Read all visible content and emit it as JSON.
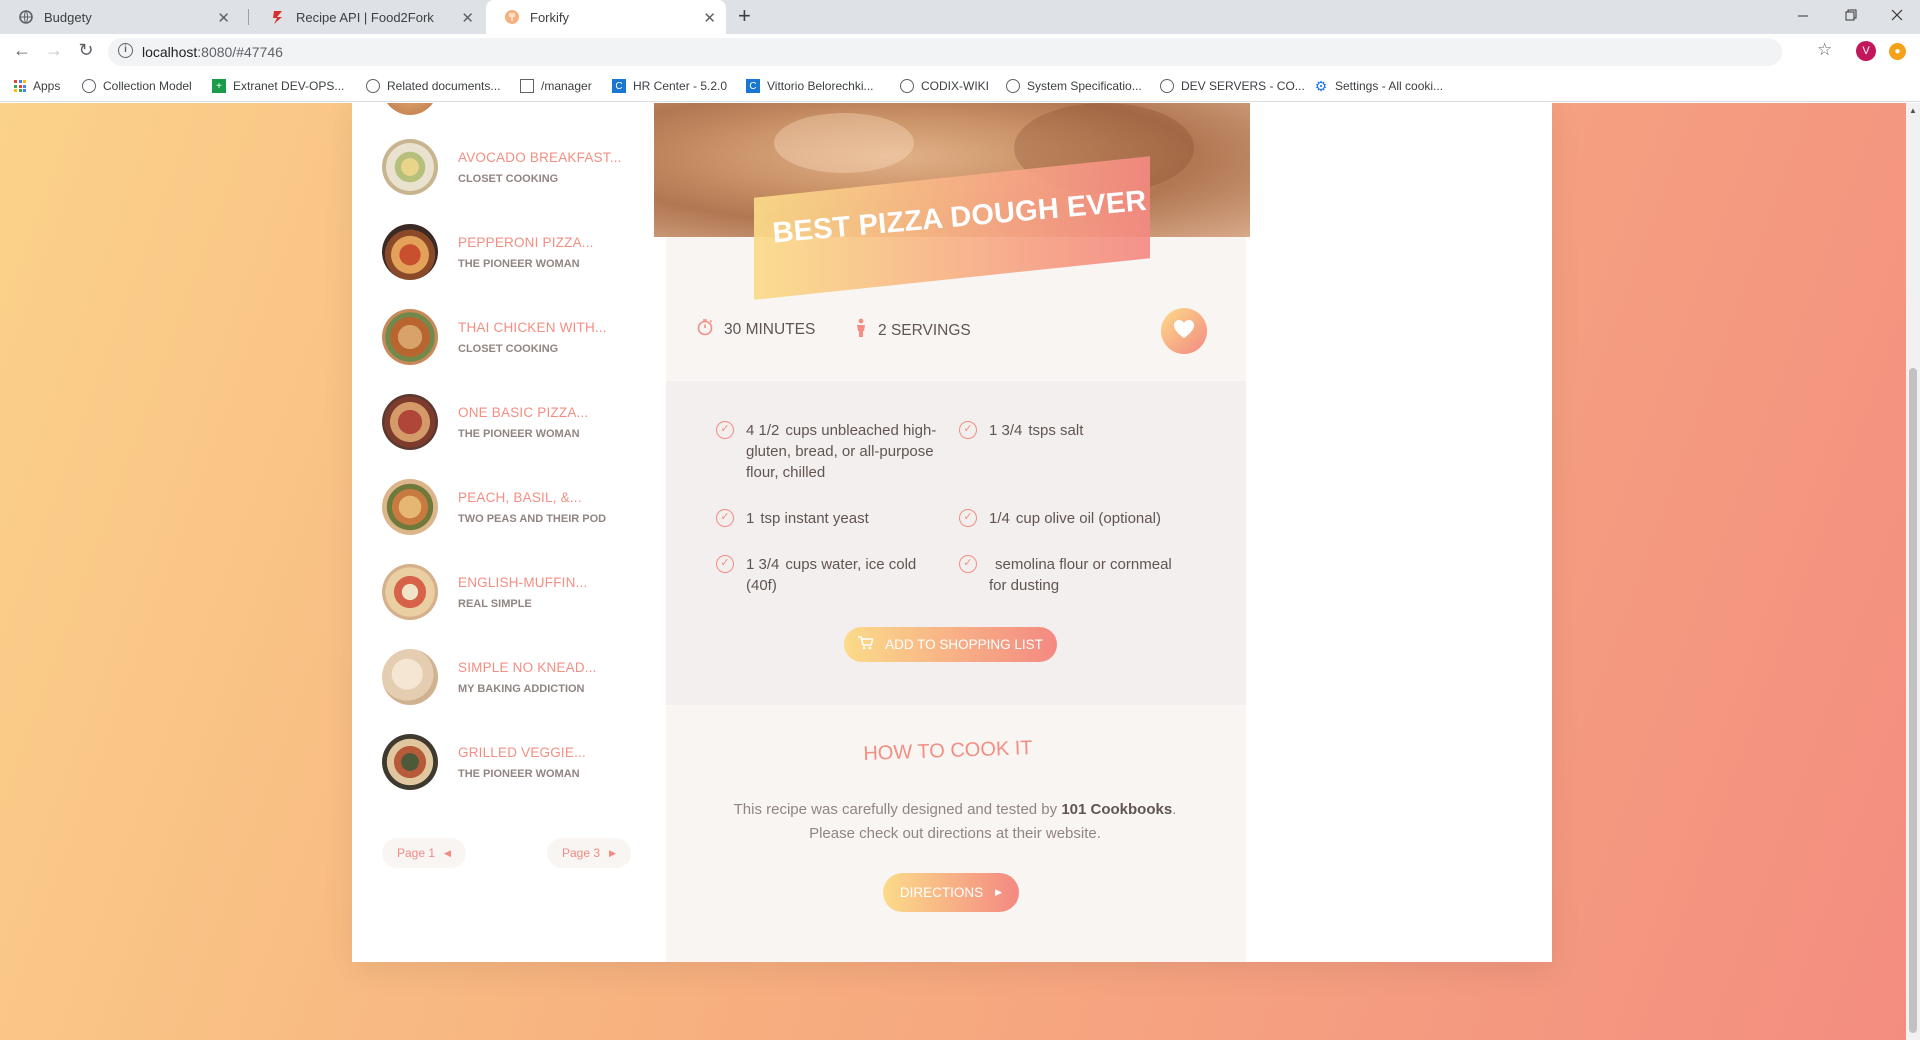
{
  "browser": {
    "tabs": [
      {
        "title": "Budgety",
        "close": "✕"
      },
      {
        "title": "Recipe API | Food2Fork",
        "close": "✕"
      },
      {
        "title": "Forkify",
        "close": "✕"
      }
    ],
    "new_tab": "+",
    "url_host": "localhost",
    "url_rest": ":8080/#47746",
    "profile_initial": "V",
    "bookmarks": [
      "Apps",
      "Collection Model",
      "Extranet DEV-OPS...",
      "Related documents...",
      "/manager",
      "HR Center - 5.2.0",
      "Vittorio Belorechki...",
      "CODIX-WIKI",
      "System Specificatio...",
      "DEV SERVERS - CO...",
      "Settings - All cooki..."
    ]
  },
  "results": {
    "items": [
      {
        "title": "Avocado Breakfast...",
        "publisher": "Closet Cooking"
      },
      {
        "title": "Pepperoni Pizza...",
        "publisher": "The Pioneer Woman"
      },
      {
        "title": "Thai Chicken With...",
        "publisher": "Closet Cooking"
      },
      {
        "title": "One Basic Pizza...",
        "publisher": "The Pioneer Woman"
      },
      {
        "title": "Peach, Basil, &...",
        "publisher": "Two Peas and Their Pod"
      },
      {
        "title": "English-Muffin...",
        "publisher": "Real Simple"
      },
      {
        "title": "Simple No Knead...",
        "publisher": "My Baking Addiction"
      },
      {
        "title": "Grilled Veggie...",
        "publisher": "The Pioneer Woman"
      }
    ],
    "prev_page": "Page 1",
    "next_page": "Page 3"
  },
  "recipe": {
    "title": "Best Pizza Dough Ever",
    "time_value": "30",
    "time_unit": "minutes",
    "servings_value": "2",
    "servings_unit": "servings",
    "ingredients": [
      {
        "qty": "4 1/2",
        "text": "cups unbleached high-gluten, bread, or all-purpose flour, chilled"
      },
      {
        "qty": "1 3/4",
        "text": "tsps salt"
      },
      {
        "qty": "1",
        "text": "tsp instant yeast"
      },
      {
        "qty": "1/4",
        "text": "cup olive oil (optional)"
      },
      {
        "qty": "1 3/4",
        "text": "cups water, ice cold (40f)"
      },
      {
        "qty": "",
        "text": "semolina flour or cornmeal for dusting"
      }
    ],
    "add_to_list_label": "Add to shopping list",
    "howto_heading": "How to cook it",
    "howto_text_before": "This recipe was carefully designed and tested by ",
    "howto_publisher": "101 Cookbooks",
    "howto_text_after": ". Please check out directions at their website.",
    "directions_label": "Directions"
  },
  "colors": {
    "accent": "#f38e82",
    "gradient_start": "#fbdb89",
    "gradient_end": "#f48982"
  }
}
